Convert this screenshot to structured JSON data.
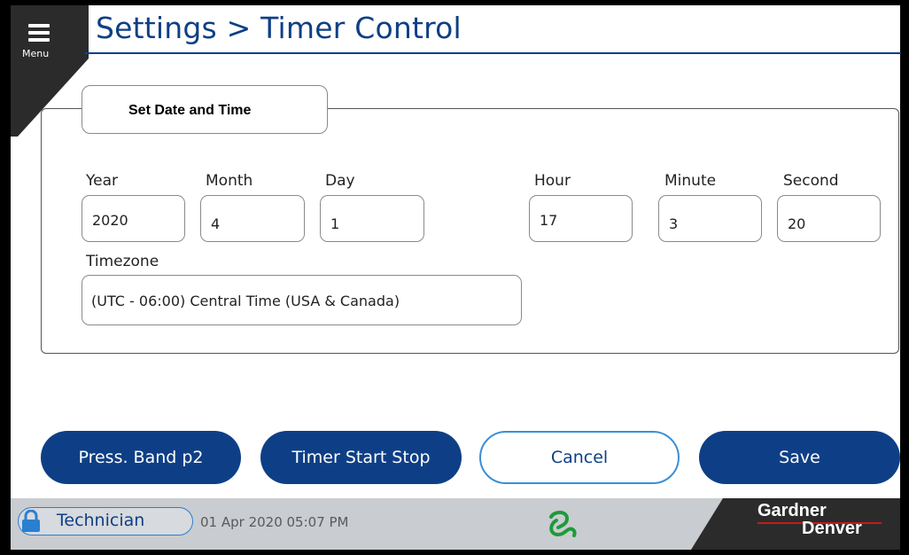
{
  "header": {
    "menu_label": "Menu",
    "title": "Settings > Timer Control"
  },
  "group": {
    "title": "Set Date and Time"
  },
  "fields": {
    "year": {
      "label": "Year",
      "value": "2020"
    },
    "month": {
      "label": "Month",
      "value": "4"
    },
    "day": {
      "label": "Day",
      "value": "1"
    },
    "hour": {
      "label": "Hour",
      "value": "17"
    },
    "minute": {
      "label": "Minute",
      "value": "3"
    },
    "second": {
      "label": "Second",
      "value": "20"
    },
    "timezone": {
      "label": "Timezone",
      "value": "(UTC - 06:00) Central Time (USA & Canada)"
    }
  },
  "buttons": {
    "press_band": "Press. Band p2",
    "timer_start_stop": "Timer Start Stop",
    "cancel": "Cancel",
    "save": "Save"
  },
  "status_bar": {
    "user_role": "Technician",
    "datetime": "01 Apr 2020  05:07 PM",
    "logo_line1": "Gardner",
    "logo_line2": "Denver"
  },
  "colors": {
    "primary": "#0e3f86",
    "outline_accent": "#3a8fd6",
    "status_bar": "#c9ccd0",
    "brand_green": "#1e9a3a",
    "logo_red": "#c21c1c"
  },
  "icons": {
    "menu": "hamburger-icon",
    "lock": "lock-icon",
    "brand": "brand-symbol-icon"
  }
}
